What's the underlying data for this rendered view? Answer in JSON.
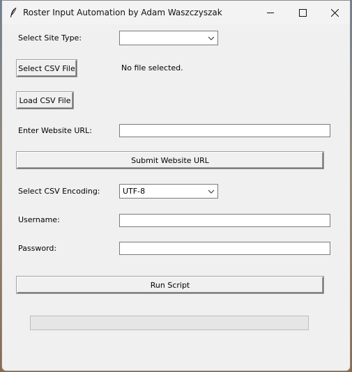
{
  "window": {
    "title": "Roster Input Automation by Adam Waszczyszak",
    "icons": {
      "app": "feather-icon",
      "minimize": "minimize-icon",
      "maximize": "maximize-icon",
      "close": "close-icon"
    }
  },
  "form": {
    "site_type": {
      "label": "Select Site Type:",
      "value": ""
    },
    "select_csv_button": "Select CSV File",
    "file_status": "No file selected.",
    "load_csv_button": "Load CSV File",
    "website_url": {
      "label": "Enter Website URL:",
      "value": ""
    },
    "submit_url_button": "Submit Website URL",
    "encoding": {
      "label": "Select CSV Encoding:",
      "value": "UTF-8"
    },
    "username": {
      "label": "Username:",
      "value": ""
    },
    "password": {
      "label": "Password:",
      "value": ""
    },
    "run_button": "Run Script",
    "progress": 0
  },
  "colors": {
    "window_bg": "#f0f0f0",
    "progress_fill": "#06b025"
  }
}
